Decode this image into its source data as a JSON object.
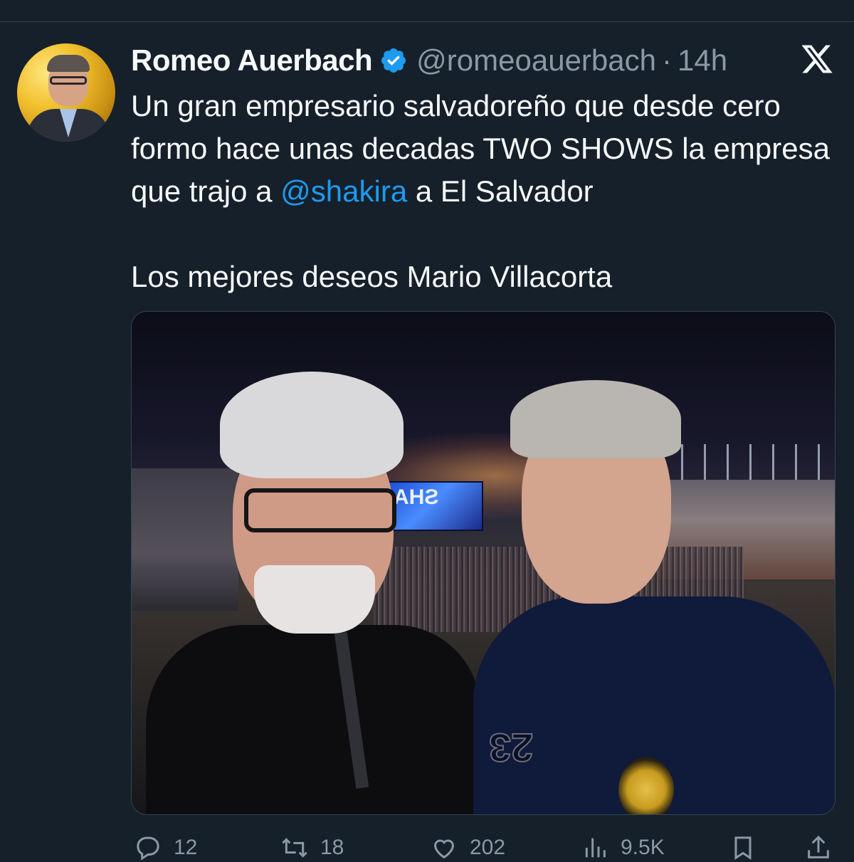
{
  "tweet": {
    "author": {
      "display_name": "Romeo Auerbach",
      "handle": "@romeoauerbach",
      "separator": "·",
      "time": "14h",
      "verified": true
    },
    "text": {
      "line_part1": "Un gran empresario salvadoreño que desde cero formo hace unas decadas TWO SHOWS la empresa que trajo a ",
      "mention": "@shakira",
      "line_part2": " a El Salvador",
      "paragraph2": "Los mejores deseos Mario Villacorta"
    },
    "photo": {
      "screen_text": "SHA",
      "jersey_number": "23"
    },
    "actions": {
      "reply_count": "12",
      "retweet_count": "18",
      "like_count": "202",
      "views_count": "9.5K"
    }
  },
  "icons": {
    "brand": "x-logo-icon",
    "verified": "verified-badge-icon",
    "reply": "reply-icon",
    "retweet": "retweet-icon",
    "like": "heart-icon",
    "views": "views-icon",
    "bookmark": "bookmark-icon",
    "share": "share-icon"
  },
  "colors": {
    "background": "#15202b",
    "text": "#f7f9f9",
    "secondary_text": "#8b98a5",
    "accent": "#1d9bf0"
  }
}
